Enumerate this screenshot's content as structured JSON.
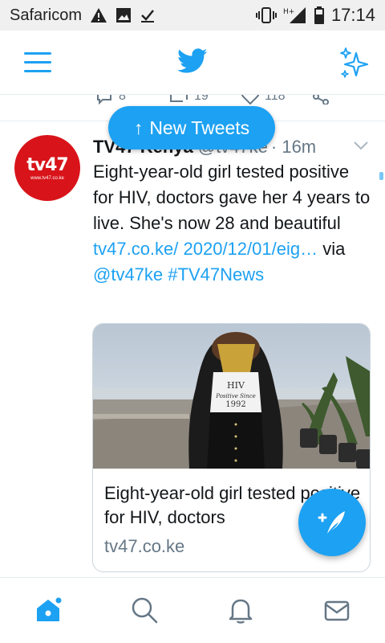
{
  "status_bar": {
    "carrier": "Safaricom",
    "network": "H+",
    "time": "17:14",
    "left_icons": [
      "warning-icon",
      "image-icon",
      "download-done-icon"
    ],
    "right_icons": [
      "vibrate-icon",
      "signal-icon",
      "battery-icon"
    ]
  },
  "header": {
    "menu_icon": "menu-icon",
    "logo_icon": "twitter-bird-icon",
    "sparkle_icon": "sparkle-icon"
  },
  "prev_tweet_actions": {
    "replies": "8",
    "retweets": "19",
    "likes": "118"
  },
  "tweet": {
    "author_name": "TV47 Kenya",
    "author_handle": "@tv47ke",
    "time": "· 16m",
    "avatar": {
      "logo_text": "tv47",
      "logo_sub": "www.tv47.co.ke",
      "color": "#d8141a"
    },
    "text_plain": "Eight-year-old girl tested positive for HIV, doctors gave her 4 years to live. She's now 28 and beautiful",
    "link": "tv47.co.ke/ 2020/12/01/eig…",
    "via": "via",
    "mention": "@tv47ke",
    "hashtag": "#TV47News"
  },
  "card": {
    "image_shirt_text_1": "HIV",
    "image_shirt_text_2": "Positive Since",
    "image_shirt_text_3": "1992",
    "title": "Eight-year-old girl tested positive for HIV, doctors",
    "domain": "tv47.co.ke"
  },
  "new_tweets": {
    "label": "New Tweets",
    "arrow": "↑"
  },
  "fab": {
    "icon": "compose-tweet-icon"
  },
  "bottom_nav": {
    "items": [
      "home-icon",
      "search-icon",
      "notifications-icon",
      "messages-icon"
    ]
  },
  "colors": {
    "accent": "#1da1f2",
    "text": "#14171a",
    "muted": "#657786"
  }
}
